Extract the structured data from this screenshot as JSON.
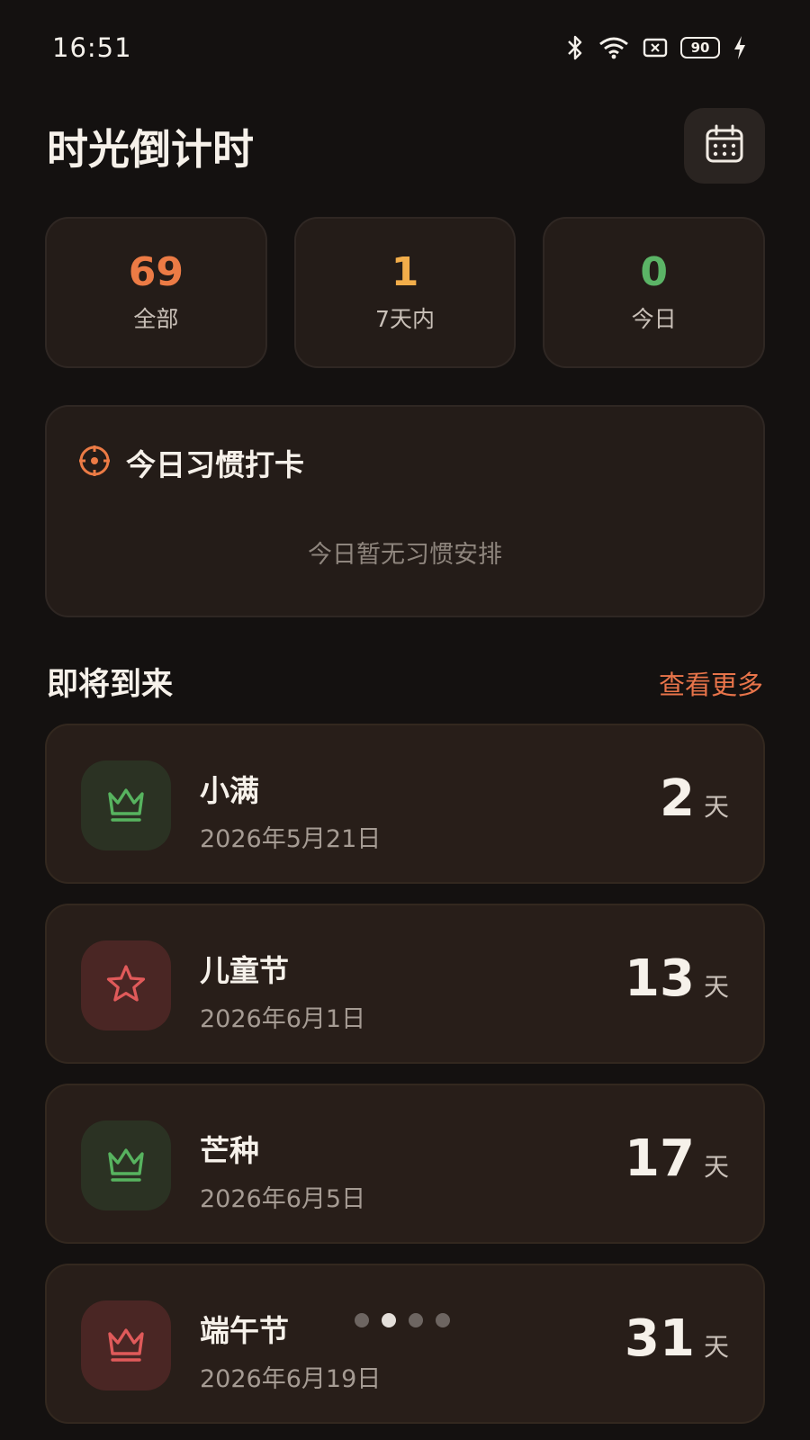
{
  "status_bar": {
    "time": "16:51",
    "battery": "90"
  },
  "header": {
    "title": "时光倒计时"
  },
  "stats": [
    {
      "value": "69",
      "label": "全部",
      "color": "#ec7b45"
    },
    {
      "value": "1",
      "label": "7天内",
      "color": "#f2ad4a"
    },
    {
      "value": "0",
      "label": "今日",
      "color": "#5bb466"
    }
  ],
  "habit": {
    "title": "今日习惯打卡",
    "empty_text": "今日暂无习惯安排"
  },
  "upcoming": {
    "title": "即将到来",
    "see_more": "查看更多",
    "events": [
      {
        "name": "小满",
        "date": "2026年5月21日",
        "days": "2",
        "unit": "天",
        "icon": "crown-icon",
        "theme": "green"
      },
      {
        "name": "儿童节",
        "date": "2026年6月1日",
        "days": "13",
        "unit": "天",
        "icon": "star-icon",
        "theme": "red"
      },
      {
        "name": "芒种",
        "date": "2026年6月5日",
        "days": "17",
        "unit": "天",
        "icon": "crown-icon",
        "theme": "green"
      },
      {
        "name": "端午节",
        "date": "2026年6月19日",
        "days": "31",
        "unit": "天",
        "icon": "crown-icon",
        "theme": "red"
      }
    ]
  },
  "pagination": {
    "count": 4,
    "active_index": 1
  }
}
